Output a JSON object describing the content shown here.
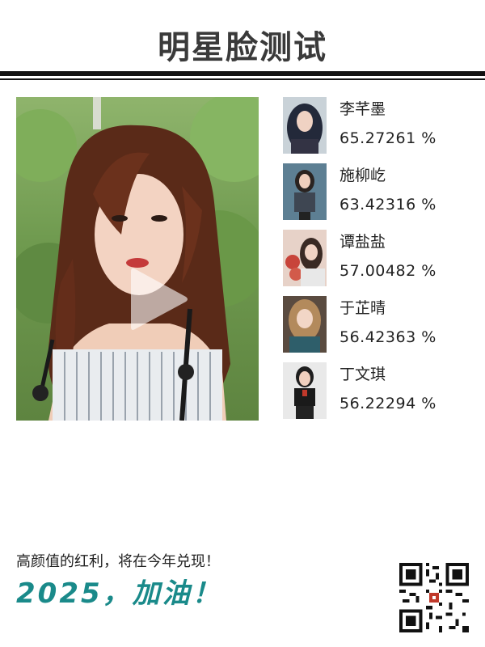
{
  "header": {
    "title": "明星脸测试"
  },
  "photo": {
    "play_icon": "play-icon"
  },
  "matches": [
    {
      "name": "李芊墨",
      "score": "65.27261 %",
      "thumb_color": "#2a3142"
    },
    {
      "name": "施柳屹",
      "score": "63.42316 %",
      "thumb_color": "#3a5a6a"
    },
    {
      "name": "谭盐盐",
      "score": "57.00482 %",
      "thumb_color": "#b96a5a"
    },
    {
      "name": "于芷晴",
      "score": "56.42363 %",
      "thumb_color": "#8a6a52"
    },
    {
      "name": "丁文琪",
      "score": "56.22294 %",
      "thumb_color": "#7b2a2a"
    }
  ],
  "footer": {
    "slogan": "高颜值的红利，将在今年兑现！",
    "cheer": "2025，加油！",
    "qr_icon": "qr-code-icon",
    "accent": "#1a8a8a"
  }
}
